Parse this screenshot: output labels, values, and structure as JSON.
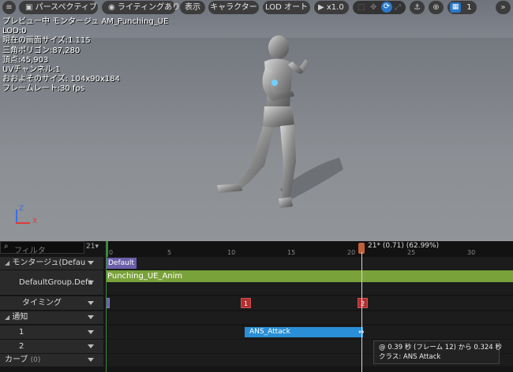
{
  "toolbar": {
    "perspective_label": "パースペクティブ",
    "lighting_label": "ライティングあり",
    "show_label": "表示",
    "character_label": "キャラクター",
    "lod_label": "LOD オート",
    "speed_label": "x1.0",
    "grid_count": "1"
  },
  "viewport_info": {
    "line1": "プレビュー中 モンタージュ AM_Punching_UE",
    "line2": "LOD:0",
    "line3": "現在の画面サイズ:1.115",
    "line4": "三角ポリゴン:87,280",
    "line5": "頂点:45,903",
    "line6": "UVチャンネル:1",
    "line7": "おおよそのサイズ: 104x90x184",
    "line8": "フレームレート:30 fps"
  },
  "axis": {
    "z": "Z",
    "x": "X"
  },
  "timeline": {
    "filter_placeholder": "フィルタ",
    "frame_count": "21",
    "playhead_label": "21",
    "playhead_detail": "(0.71) (62.99%)",
    "ruler_ticks": [
      "0",
      "5",
      "10",
      "15",
      "20",
      "25",
      "30"
    ],
    "rows": {
      "montage_label": "モンタージュ(Defau",
      "group_label": "DefaultGroup.Defa",
      "timing_label": "タイミング",
      "notify_label": "通知",
      "track1_label": "1",
      "track2_label": "2",
      "curve_label": "カーブ",
      "curve_count": "(0)"
    },
    "default_section": "Default",
    "anim_segment": "Punching_UE_Anim",
    "timing_markers": [
      "1",
      "1",
      "2"
    ],
    "notify_name": "ANS_Attack",
    "tooltip_line1": "@ 0.39 秒 (フレーム 12) から 0.324 秒",
    "tooltip_line2": "クラス: ANS Attack"
  },
  "colors": {
    "anim_green": "#7aa23a",
    "notify_blue": "#2a8fd6",
    "marker_red": "#b03030",
    "default_purple": "#6a5fa8",
    "grid_active": "#2a78c8"
  }
}
